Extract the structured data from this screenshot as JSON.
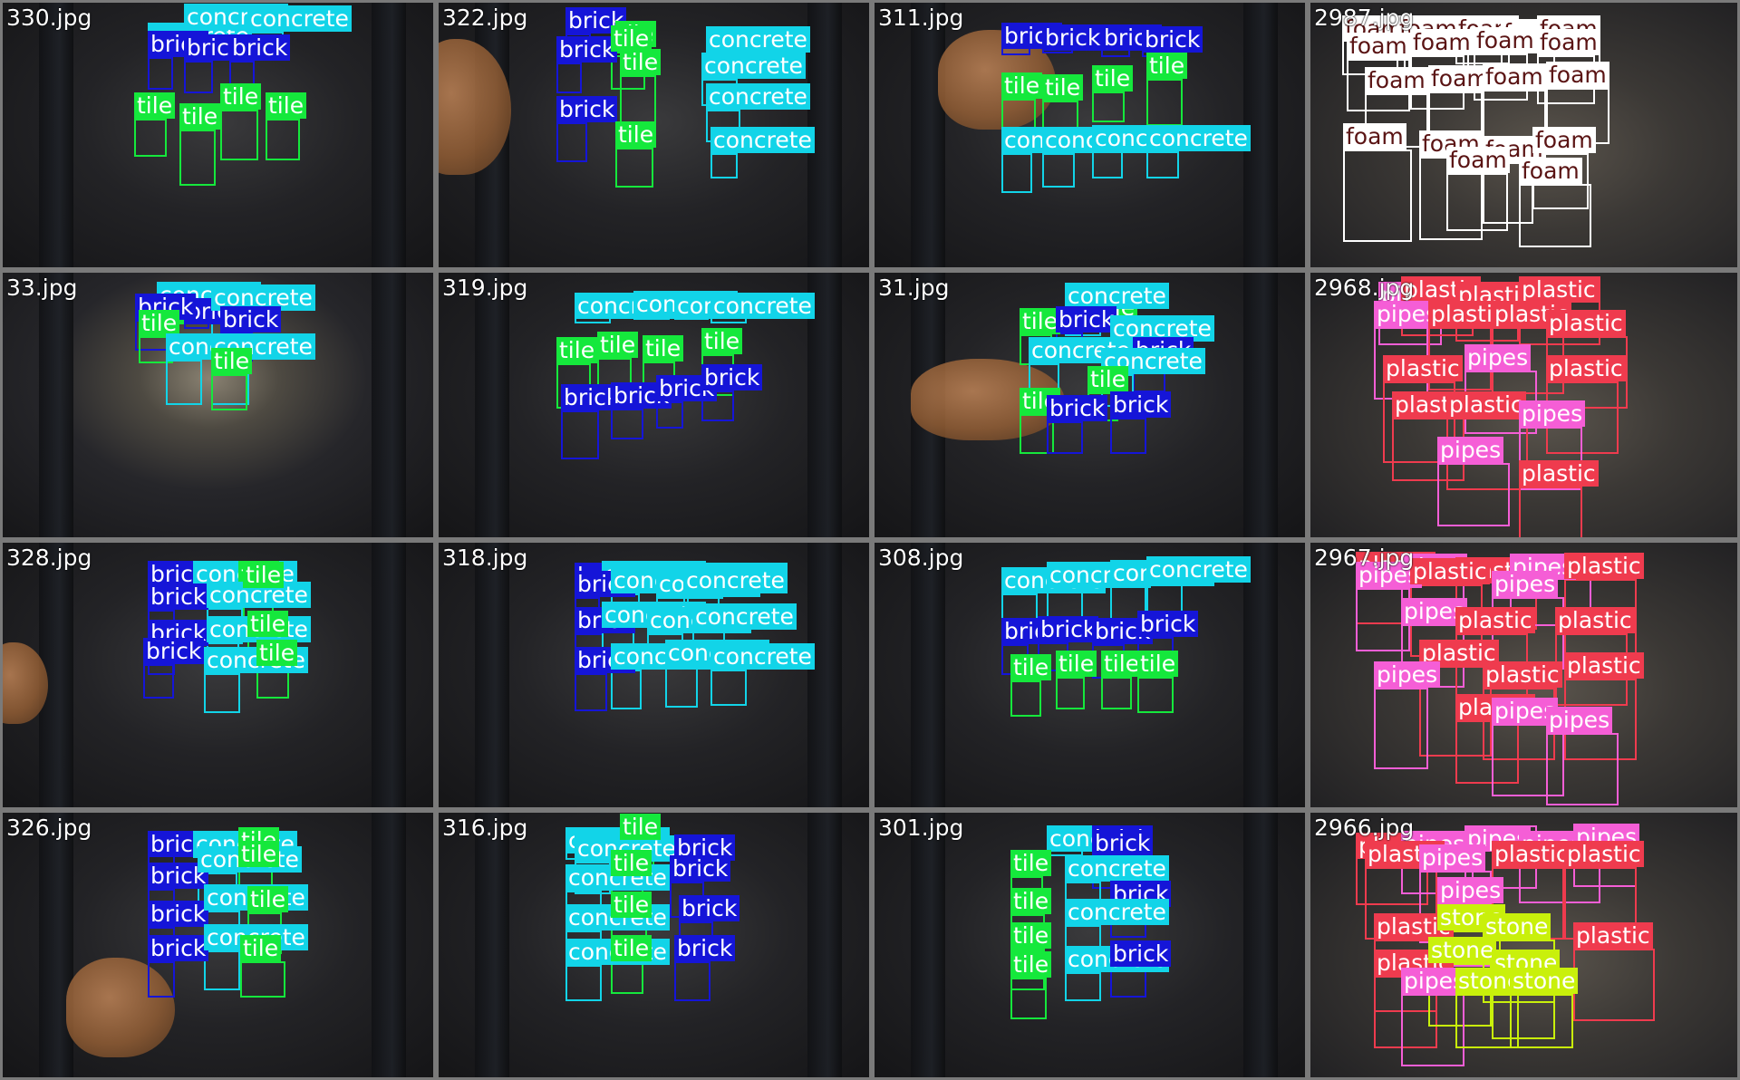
{
  "colors": {
    "brick": "#1515d8",
    "concrete": "#12d4e8",
    "tile": "#15e83c",
    "foam": "#ffffff",
    "plastic": "#ef3b4e",
    "pipes": "#f55ed6",
    "stone": "#c9f00b"
  },
  "grid": {
    "columns": 4,
    "rows": 4,
    "tiles": [
      {
        "file": "330.jpg"
      },
      {
        "file": "322.jpg"
      },
      {
        "file": "311.jpg"
      },
      {
        "file": "2987.jpg"
      },
      {
        "file": "33.jpg"
      },
      {
        "file": "319.jpg"
      },
      {
        "file": "31.jpg"
      },
      {
        "file": "2968.jpg"
      },
      {
        "file": "328.jpg"
      },
      {
        "file": "318.jpg"
      },
      {
        "file": "308.jpg"
      },
      {
        "file": "2967.jpg"
      },
      {
        "file": "326.jpg"
      },
      {
        "file": "316.jpg"
      },
      {
        "file": "301.jpg"
      },
      {
        "file": "2966.jpg"
      }
    ]
  }
}
